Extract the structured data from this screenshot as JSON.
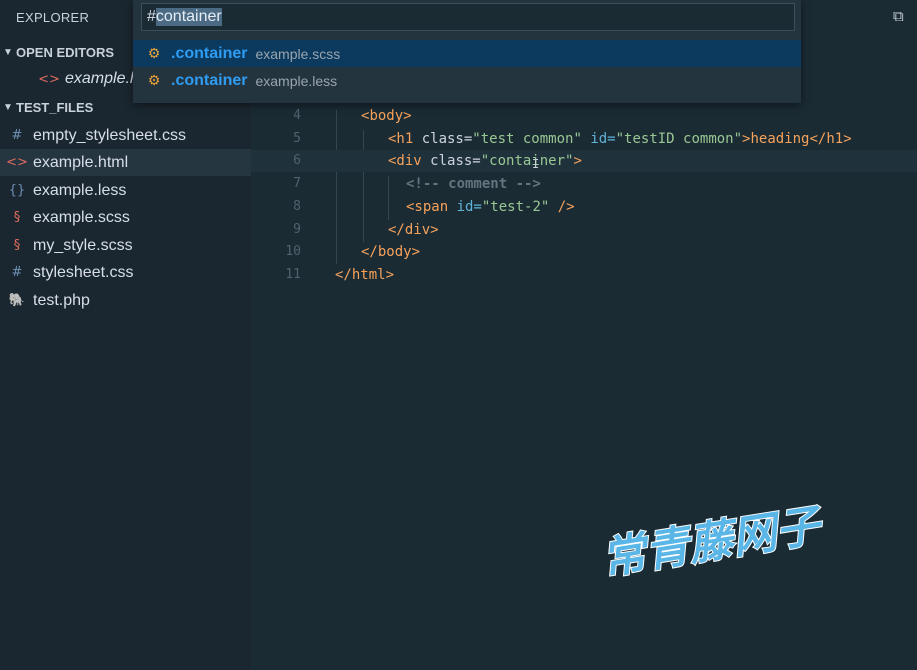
{
  "sidebar": {
    "title": "EXPLORER",
    "open_editors": {
      "header": "OPEN EDITORS",
      "items": [
        {
          "icon": "html-file-icon",
          "label": "example.html"
        }
      ]
    },
    "folder": {
      "header": "TEST_FILES",
      "files": [
        {
          "icon": "css-file-icon",
          "glyph": "#",
          "color": "#6d8fb3",
          "label": "empty_stylesheet.css"
        },
        {
          "icon": "html-file-icon",
          "glyph": "<>",
          "color": "#e06c5d",
          "label": "example.html"
        },
        {
          "icon": "less-file-icon",
          "glyph": "{}",
          "color": "#6d8fb3",
          "label": "example.less"
        },
        {
          "icon": "sass-file-icon",
          "glyph": "§",
          "color": "#e06c5d",
          "label": "example.scss"
        },
        {
          "icon": "sass-file-icon",
          "glyph": "§",
          "color": "#e06c5d",
          "label": "my_style.scss"
        },
        {
          "icon": "css-file-icon",
          "glyph": "#",
          "color": "#6d8fb3",
          "label": "stylesheet.css"
        },
        {
          "icon": "php-file-icon",
          "glyph": "🐘",
          "color": "#8aa4c8",
          "label": "test.php"
        }
      ]
    }
  },
  "quick_open": {
    "prefix": "#",
    "query": "container",
    "results": [
      {
        "icon": "symbol-class-icon",
        "label": ".container",
        "description": "example.scss"
      },
      {
        "icon": "symbol-class-icon",
        "label": ".container",
        "description": "example.less"
      }
    ]
  },
  "editor": {
    "lines": [
      {
        "n": "4",
        "tokens": [
          [
            "t-tag",
            "<"
          ],
          [
            "t-tag",
            "body"
          ],
          [
            "t-tag",
            ">"
          ]
        ]
      },
      {
        "n": "5",
        "tokens": [
          [
            "t-tag",
            "<h1 "
          ],
          [
            "t-attr",
            "class="
          ],
          [
            "t-str",
            "\"test common\" "
          ],
          [
            "t-id",
            "id="
          ],
          [
            "t-str",
            "\"testID common\""
          ],
          [
            "t-tag",
            ">"
          ],
          [
            "t-txt",
            "heading"
          ],
          [
            "t-tag",
            "</h1>"
          ]
        ]
      },
      {
        "n": "6",
        "tokens": [
          [
            "t-tag",
            "<div "
          ],
          [
            "t-attr",
            "class="
          ],
          [
            "t-str",
            "\"container\""
          ],
          [
            "t-tag",
            ">"
          ]
        ]
      },
      {
        "n": "7",
        "tokens": [
          [
            "t-com",
            "<!-- comment -->"
          ]
        ]
      },
      {
        "n": "8",
        "tokens": [
          [
            "t-tag",
            "<span "
          ],
          [
            "t-id",
            "id="
          ],
          [
            "t-str",
            "\"test-2\" "
          ],
          [
            "t-tag",
            "/>"
          ]
        ]
      },
      {
        "n": "9",
        "tokens": [
          [
            "t-tag",
            "</div>"
          ]
        ]
      },
      {
        "n": "10",
        "tokens": [
          [
            "t-tag",
            "</body>"
          ]
        ]
      },
      {
        "n": "11",
        "tokens": [
          [
            "t-tag",
            "</html>"
          ]
        ]
      }
    ]
  },
  "watermark": {
    "text": "常青藤网子"
  },
  "colors": {
    "accent": "#2e9cf3",
    "selection": "#0b3a5e",
    "tag": "#f6a25b",
    "string": "#99c794"
  }
}
